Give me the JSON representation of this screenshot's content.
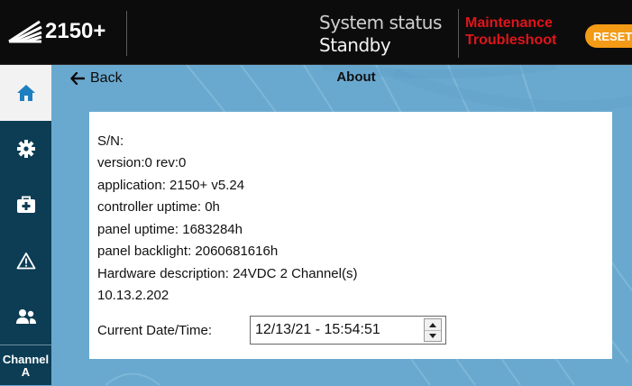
{
  "header": {
    "app_name": "2150+",
    "status_label": "System status",
    "status_value": "Standby",
    "maintenance_line1": "Maintenance",
    "maintenance_line2": "Troubleshoot",
    "reset_label": "RESET"
  },
  "sidebar": {
    "items": [
      {
        "name": "home",
        "icon": "home-icon",
        "active": true
      },
      {
        "name": "settings",
        "icon": "gear-icon"
      },
      {
        "name": "service",
        "icon": "toolbox-icon"
      },
      {
        "name": "alarms",
        "icon": "warning-icon"
      },
      {
        "name": "users",
        "icon": "users-icon"
      }
    ],
    "channel_line1": "Channel",
    "channel_line2": "A"
  },
  "nav": {
    "back_label": "Back",
    "page_title": "About"
  },
  "about": {
    "serial": "S/N:",
    "version": "version:0 rev:0",
    "application": "application: 2150+ v5.24",
    "controller_uptime": "controller uptime: 0h",
    "panel_uptime": "panel uptime: 1683284h",
    "panel_backlight": "panel backlight: 2060681616h",
    "hardware": "Hardware description: 24VDC 2 Channel(s)",
    "ip_address": "10.13.2.202",
    "datetime_label": "Current Date/Time:",
    "datetime_value": "12/13/21 - 15:54:51"
  },
  "colors": {
    "accent_orange": "#f39a16",
    "alert_red": "#e0141a",
    "sidebar_bg": "#0d3d55",
    "content_bg": "#6aa9cf"
  }
}
